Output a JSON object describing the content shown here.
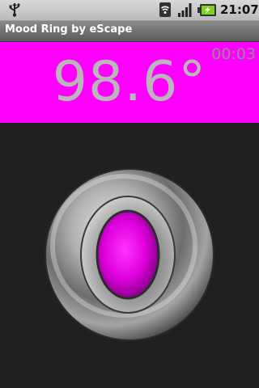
{
  "status_bar": {
    "time": "21:07",
    "icons": [
      "usb-icon",
      "wifi-icon",
      "signal-icon",
      "battery-charging-icon"
    ]
  },
  "app": {
    "title": "Mood Ring by eScape"
  },
  "mood": {
    "temperature": "98.6°",
    "timer": "00:03",
    "color": "#ff00ff",
    "stone_color": "#e000e0"
  }
}
